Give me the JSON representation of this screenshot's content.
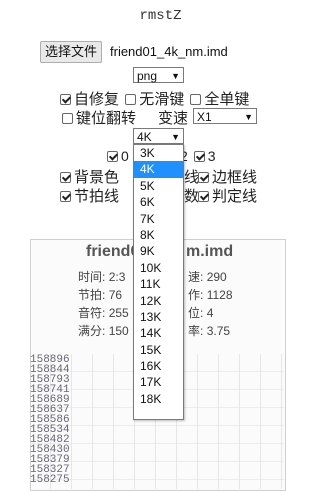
{
  "title": "rmstZ",
  "file": {
    "button_label": "选择文件",
    "filename": "friend01_4k_nm.imd"
  },
  "format": {
    "selected": "png"
  },
  "options": {
    "auto_fix": "自修复",
    "no_slide": "无滑键",
    "all_single": "全单键",
    "key_flip": "键位翻转",
    "speed_label": "变速",
    "speed_value": "X1"
  },
  "keys_select": {
    "selected": "4K",
    "options": [
      "3K",
      "4K",
      "5K",
      "6K",
      "7K",
      "8K",
      "9K",
      "10K",
      "11K",
      "12K",
      "13K",
      "14K",
      "15K",
      "16K",
      "17K",
      "18K"
    ]
  },
  "partial_row": {
    "c0": "0",
    "c2": "2",
    "c3": "3"
  },
  "toggles": {
    "bg_color": "背景色",
    "line": "线",
    "border_line": "边框线",
    "beat_line": "节拍线",
    "count": "数",
    "judge_line": "判定线"
  },
  "preview": {
    "title_left": "friend0",
    "title_right": "m.imd",
    "stats": {
      "time_label": "时间:",
      "time_val": "2:3",
      "speed_label": "速:",
      "speed_val": "290",
      "beat_label": "节拍:",
      "beat_val": "76",
      "action_label": "作:",
      "action_val": "1128",
      "note_label": "音符:",
      "note_val": "255",
      "pos_label": "位:",
      "pos_val": "4",
      "full_label": "满分:",
      "full_val": "150",
      "rate_label": "率:",
      "rate_val": "3.75"
    },
    "row_numbers": [
      "158896",
      "158844",
      "158793",
      "158741",
      "158689",
      "158637",
      "158586",
      "158534",
      "158482",
      "158430",
      "158379",
      "158327",
      "158275"
    ]
  }
}
